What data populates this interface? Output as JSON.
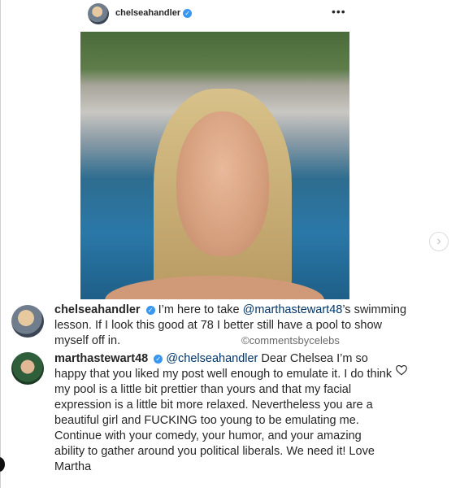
{
  "post": {
    "username": "chelseahandler",
    "more_icon": "•••"
  },
  "photo": {
    "icon": "photo-of-woman-in-pool"
  },
  "carousel": {
    "next_icon": "›"
  },
  "comments": [
    {
      "user": "chelseahandler",
      "verified_icon": "✓",
      "text_before": " I’m here to take ",
      "mention": "@marthastewart48",
      "text_after": "’s swimming lesson. If I look this good at 78 I better still have a pool to show myself off in."
    },
    {
      "user": "marthastewart48",
      "verified_icon": "✓",
      "mention": "@chelseahandler",
      "text_after": " Dear Chelsea I’m so happy that you liked my post well enough to emulate it. I do think my pool is a little bit prettier than yours and that my facial expression is a little bit more relaxed. Nevertheless you are a beautiful girl and FUCKING too young to be emulating me. Continue with your comedy, your humor, and your amazing ability to gather around you political liberals. We need it! Love Martha"
    }
  ],
  "watermark": "©commentsbycelebs",
  "colors": {
    "verified": "#3897f0",
    "text": "#262626",
    "mention": "#003569"
  }
}
